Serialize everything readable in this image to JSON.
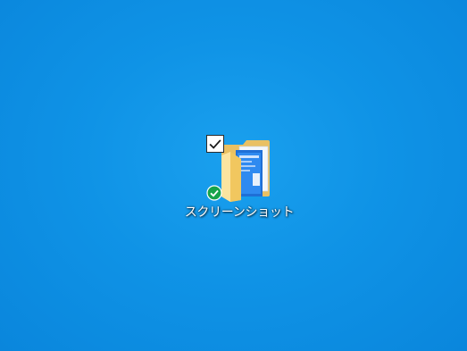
{
  "desktop": {
    "background_color": "#1095e8",
    "icons": [
      {
        "label": "スクリーンショット",
        "type": "folder",
        "selected": true,
        "icon": "folder-icon",
        "status": "synced",
        "status_icon": "sync-ok-check-icon",
        "status_color": "#16a34a"
      }
    ]
  }
}
